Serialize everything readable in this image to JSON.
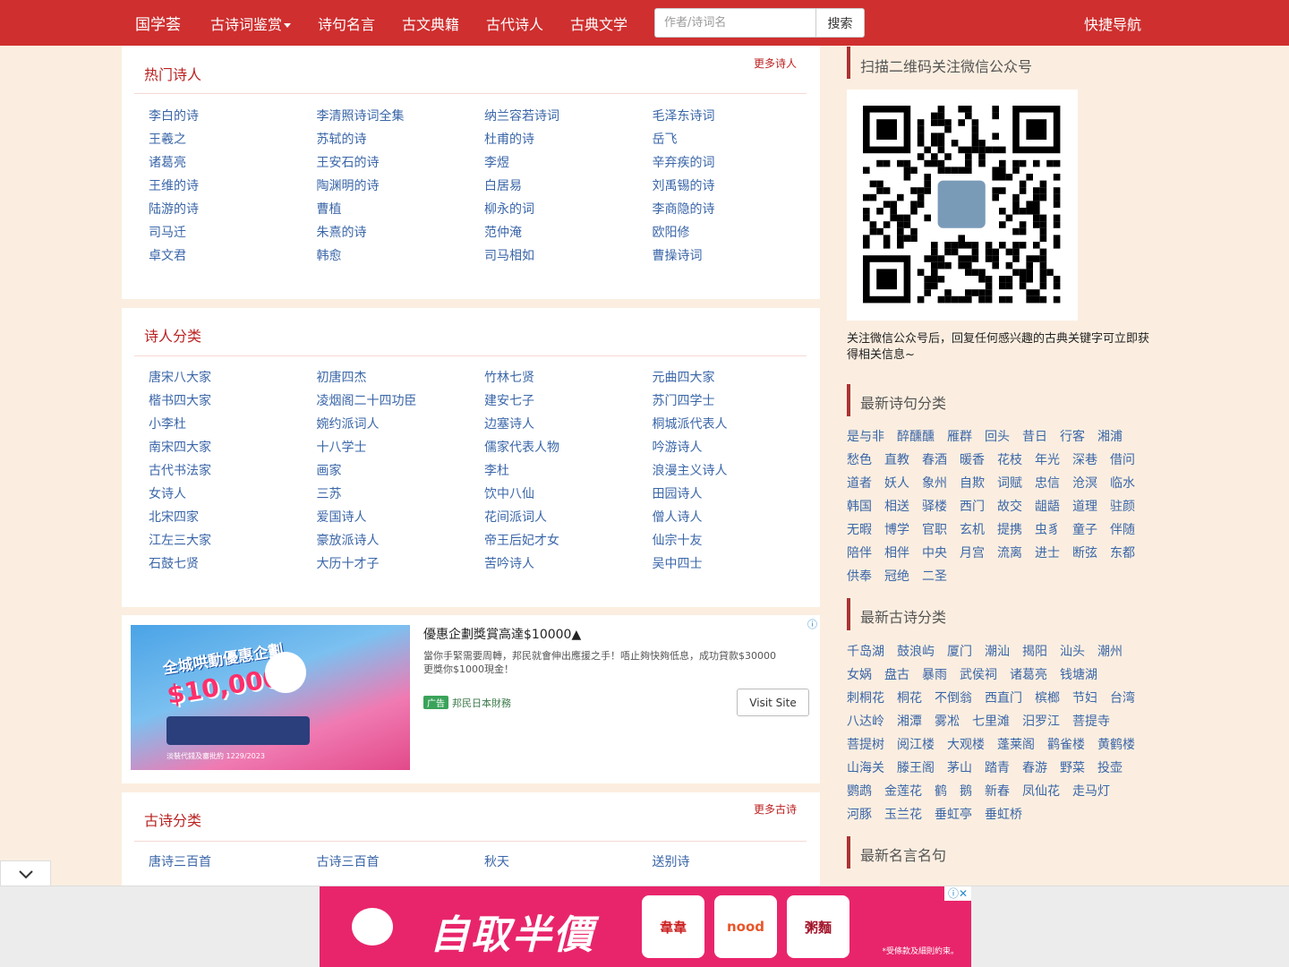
{
  "nav": {
    "brand": "国学荟",
    "items": [
      "古诗词鉴赏",
      "诗句名言",
      "古文典籍",
      "古代诗人",
      "古典文学"
    ],
    "search_placeholder": "作者/诗词名",
    "search_button": "搜索",
    "quick_nav": "快捷导航"
  },
  "hot_poets": {
    "title": "热门诗人",
    "more": "更多诗人",
    "items": [
      "李白的诗",
      "李清照诗词全集",
      "纳兰容若诗词",
      "毛泽东诗词",
      "王羲之",
      "苏轼的诗",
      "杜甫的诗",
      "岳飞",
      "诸葛亮",
      "王安石的诗",
      "李煜",
      "辛弃疾的词",
      "王维的诗",
      "陶渊明的诗",
      "白居易",
      "刘禹锡的诗",
      "陆游的诗",
      "曹植",
      "柳永的词",
      "李商隐的诗",
      "司马迁",
      "朱熹的诗",
      "范仲淹",
      "欧阳修",
      "卓文君",
      "韩愈",
      "司马相如",
      "曹操诗词"
    ]
  },
  "poet_categories": {
    "title": "诗人分类",
    "items": [
      "唐宋八大家",
      "初唐四杰",
      "竹林七贤",
      "元曲四大家",
      "楷书四大家",
      "凌烟阁二十四功臣",
      "建安七子",
      "苏门四学士",
      "小李杜",
      "婉约派词人",
      "边塞诗人",
      "桐城派代表人",
      "南宋四大家",
      "十八学士",
      "儒家代表人物",
      "吟游诗人",
      "古代书法家",
      "画家",
      "李杜",
      "浪漫主义诗人",
      "女诗人",
      "三苏",
      "饮中八仙",
      "田园诗人",
      "北宋四家",
      "爱国诗人",
      "花间派词人",
      "僧人诗人",
      "江左三大家",
      "豪放派诗人",
      "帝王后妃才女",
      "仙宗十友",
      "石鼓七贤",
      "大历十才子",
      "苦吟诗人",
      "吴中四士"
    ]
  },
  "ad": {
    "info_icon": "ⓘ",
    "title": "優惠企劃獎賞高達$10000▲",
    "desc": "當你手緊需要周轉，邦民就會伸出應援之手！唔止夠快夠低息，成功貸款$30000更獎你$1000現金！",
    "tag": "广告",
    "source": "邦民日本財務",
    "visit": "Visit Site",
    "img_headline": "全城哄動優惠企劃",
    "img_money": "$10,000",
    "img_fine": "淡裝代錢及審批約 1229/2023"
  },
  "ancient_poem_categories": {
    "title": "古诗分类",
    "more": "更多古诗",
    "items": [
      "唐诗三百首",
      "古诗三百首",
      "秋天",
      "送别诗"
    ]
  },
  "sidebar": {
    "qr_title": "扫描二维码关注微信公众号",
    "qr_desc": "关注微信公众号后，回复任何感兴趣的古典关键字可立即获得相关信息~",
    "verse_title": "最新诗句分类",
    "verse_tags": [
      "是与非",
      "醉醺醺",
      "雁群",
      "回头",
      "昔日",
      "行客",
      "湘浦",
      "愁色",
      "直教",
      "春酒",
      "暖香",
      "花枝",
      "年光",
      "深巷",
      "借问",
      "道者",
      "妖人",
      "象州",
      "自欺",
      "词赋",
      "忠信",
      "沧溟",
      "临水",
      "韩国",
      "相送",
      "驿楼",
      "西门",
      "故交",
      "龃龉",
      "道理",
      "驻颜",
      "无暇",
      "博学",
      "官职",
      "玄机",
      "提携",
      "虫豸",
      "童子",
      "伴随",
      "陪伴",
      "相伴",
      "中央",
      "月宫",
      "流离",
      "进士",
      "断弦",
      "东都",
      "供奉",
      "冠绝",
      "二圣"
    ],
    "poem_title": "最新古诗分类",
    "poem_tags": [
      "千岛湖",
      "鼓浪屿",
      "厦门",
      "潮汕",
      "揭阳",
      "汕头",
      "潮州",
      "女娲",
      "盘古",
      "暴雨",
      "武侯祠",
      "诸葛亮",
      "钱塘湖",
      "刺桐花",
      "桐花",
      "不倒翁",
      "西直门",
      "槟榔",
      "节妇",
      "台湾",
      "八达岭",
      "湘潭",
      "雾凇",
      "七里滩",
      "汨罗江",
      "菩提寺",
      "菩提树",
      "阅江楼",
      "大观楼",
      "蓬莱阁",
      "鹳雀楼",
      "黄鹤楼",
      "山海关",
      "滕王阁",
      "茅山",
      "踏青",
      "春游",
      "野菜",
      "投壶",
      "鹦鹉",
      "金莲花",
      "鹤",
      "鹅",
      "新春",
      "凤仙花",
      "走马灯",
      "河豚",
      "玉兰花",
      "垂虹亭",
      "垂虹桥"
    ],
    "quote_title": "最新名言名句"
  },
  "bottom_ad": {
    "headline": "自取半價",
    "tile1": "韋韋",
    "tile2": "nood",
    "tile3": "粥麵",
    "tnc": "*受條款及細則約束。",
    "close": "ⓘ✕"
  }
}
